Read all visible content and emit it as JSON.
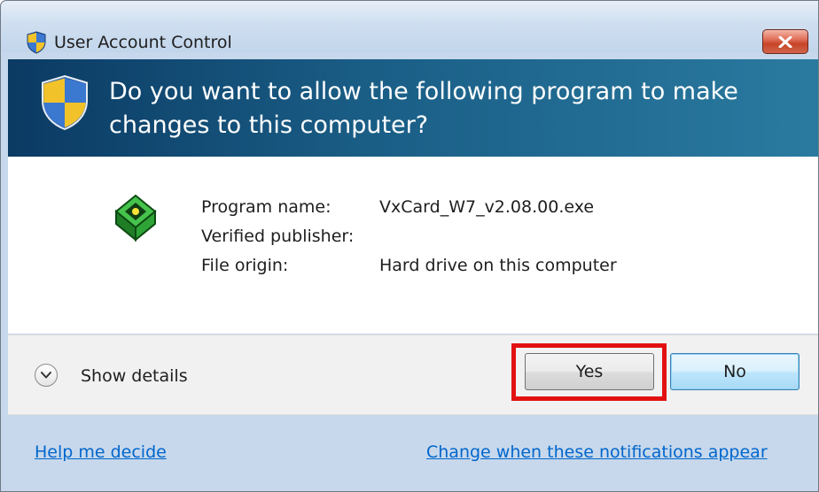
{
  "window": {
    "title": "User Account Control",
    "close_icon": "close-icon"
  },
  "header": {
    "icon": "uac-shield-icon",
    "question": "Do you want to allow the following program to make changes to this computer?"
  },
  "program": {
    "icon": "program-icon",
    "fields": [
      {
        "label": "Program name:",
        "value": "VxCard_W7_v2.08.00.exe"
      },
      {
        "label": "Verified publisher:",
        "value": ""
      },
      {
        "label": "File origin:",
        "value": "Hard drive on this computer"
      }
    ]
  },
  "details": {
    "icon": "chevron-down-icon",
    "label": "Show details"
  },
  "buttons": {
    "yes": "Yes",
    "no": "No"
  },
  "links": {
    "help": "Help me decide",
    "notifications": "Change when these notifications appear"
  },
  "colors": {
    "header_dark": "#0b3a63",
    "header_light": "#2a7aa0",
    "link": "#0066cc",
    "highlight": "#e21111"
  }
}
